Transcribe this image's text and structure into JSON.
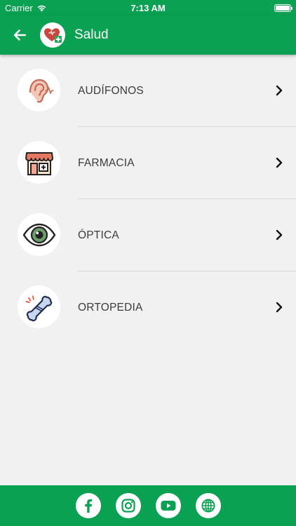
{
  "status_bar": {
    "carrier": "Carrier",
    "time": "7:13 AM",
    "icons": [
      "wifi-icon",
      "battery-icon"
    ]
  },
  "app_bar": {
    "title": "Salud",
    "back_icon": "arrow-left-icon",
    "logo_icon": "heart-plus-icon"
  },
  "categories": [
    {
      "label": "AUDÍFONOS",
      "icon": "ear-icon"
    },
    {
      "label": "FARMACIA",
      "icon": "pharmacy-store-icon"
    },
    {
      "label": "ÓPTICA",
      "icon": "eye-icon"
    },
    {
      "label": "ORTOPEDIA",
      "icon": "bone-icon"
    }
  ],
  "footer": {
    "social": [
      "facebook-icon",
      "instagram-icon",
      "youtube-icon",
      "globe-icon"
    ]
  },
  "colors": {
    "primary": "#0aa153",
    "background": "#f1f1f1",
    "text": "#3b3b3b"
  }
}
